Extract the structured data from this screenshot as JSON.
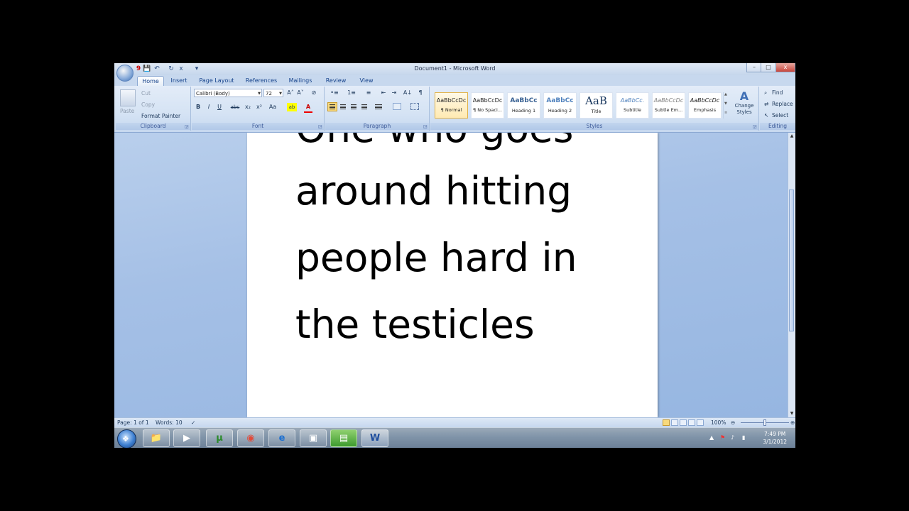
{
  "window": {
    "title": "Document1 - Microsoft Word",
    "minimize_icon": "–",
    "maximize_icon": "□",
    "close_icon": "x"
  },
  "qat": {
    "save": "💾",
    "undo": "↶",
    "redo": "↻",
    "close": "x",
    "customize": "▾",
    "badge": "9"
  },
  "tabs": [
    "Home",
    "Insert",
    "Page Layout",
    "References",
    "Mailings",
    "Review",
    "View"
  ],
  "ribbon": {
    "clipboard": {
      "label": "Clipboard",
      "paste": "Paste",
      "cut": "Cut",
      "copy": "Copy",
      "format_painter": "Format Painter"
    },
    "font": {
      "label": "Font",
      "font_name": "Calibri (Body)",
      "font_size": "72",
      "bold": "B",
      "italic": "I",
      "underline": "U",
      "strike": "abc",
      "subscript": "x₂",
      "superscript": "x²",
      "change_case": "Aa",
      "grow": "A˄",
      "shrink": "A˅",
      "clear": "⊘",
      "highlight": "ab",
      "font_color": "A"
    },
    "paragraph": {
      "label": "Paragraph",
      "bullets": "•≡",
      "numbering": "1≡",
      "multilevel": "≡",
      "dec_indent": "⇤",
      "inc_indent": "⇥",
      "sort": "A↓",
      "show_marks": "¶"
    },
    "styles": {
      "label": "Styles",
      "items": [
        {
          "sample": "AaBbCcDc",
          "name": "¶ Normal"
        },
        {
          "sample": "AaBbCcDc",
          "name": "¶ No Spaci..."
        },
        {
          "sample": "AaBbCc",
          "name": "Heading 1"
        },
        {
          "sample": "AaBbCc",
          "name": "Heading 2"
        },
        {
          "sample": "AaB",
          "name": "Title"
        },
        {
          "sample": "AaBbCc.",
          "name": "Subtitle"
        },
        {
          "sample": "AaBbCcDc",
          "name": "Subtle Em..."
        },
        {
          "sample": "AaBbCcDc",
          "name": "Emphasis"
        }
      ],
      "change_styles": "Change Styles"
    },
    "editing": {
      "label": "Editing",
      "find": "Find",
      "replace": "Replace",
      "select": "Select"
    }
  },
  "document": {
    "lines": [
      "One who goes",
      "around hitting",
      "people hard in",
      "the testicles"
    ]
  },
  "statusbar": {
    "page": "Page: 1 of 1",
    "words": "Words: 10",
    "zoom": "100%",
    "zoom_level": 1.0
  },
  "taskbar": {
    "clock_time": "7:49 PM",
    "clock_date": "3/1/2012",
    "apps": [
      {
        "id": "explorer",
        "glyph": "📁"
      },
      {
        "id": "media-player",
        "glyph": "▶"
      },
      {
        "id": "utorrent",
        "glyph": "µ"
      },
      {
        "id": "chrome",
        "glyph": "◉"
      },
      {
        "id": "internet-explorer",
        "glyph": "e"
      },
      {
        "id": "recorder",
        "glyph": "▣"
      },
      {
        "id": "game",
        "glyph": "▤"
      },
      {
        "id": "word",
        "glyph": "W"
      }
    ]
  }
}
